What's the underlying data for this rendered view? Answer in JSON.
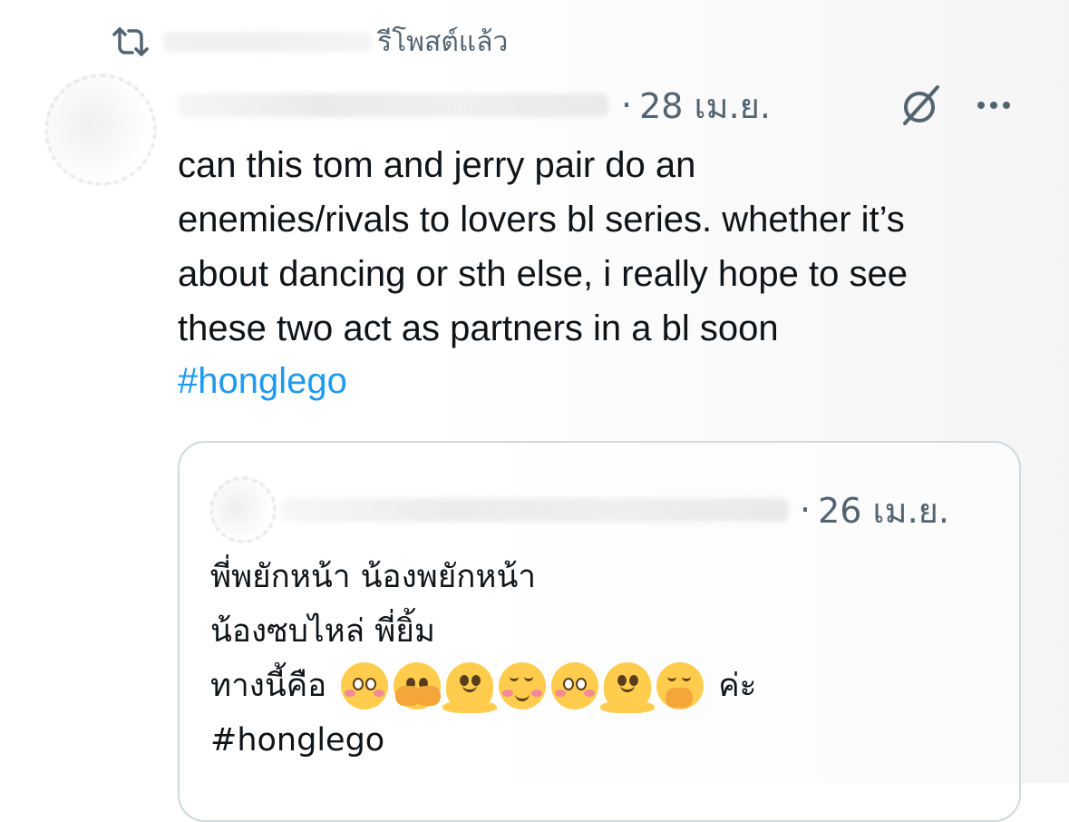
{
  "retweet": {
    "icon": "retweet-icon",
    "label": "รีโพสต์แล้ว"
  },
  "tweet": {
    "separator": "·",
    "date": "28 เม.ย.",
    "text": "can this tom and jerry pair do an\nenemies/rivals to lovers bl series. whether it’s\nabout dancing or sth else, i really hope to see\nthese two act as partners in a bl soon",
    "hashtag": "#honglego",
    "actions": {
      "grok_icon": "grok-icon",
      "more_icon": "more-icon"
    },
    "colors": {
      "hashtag": "#1d9bf0",
      "meta": "#536471",
      "text": "#0f1419",
      "border": "#cfd9de"
    }
  },
  "quote": {
    "separator": "·",
    "date": "26 เม.ย.",
    "line1": "พี่พยักหน้า น้องพยักหน้า",
    "line2": "น้องซบไหล่ พี่ยิ้ม",
    "line3_text": "ทางนี้คือ",
    "line3_suffix": "ค่ะ",
    "emojis": [
      "flushed-face",
      "face-with-open-eyes-and-hand-over-mouth",
      "melting-face",
      "smiling-face",
      "flushed-face",
      "melting-face",
      "face-with-hand-over-mouth"
    ],
    "hashtag": "#honglego"
  }
}
